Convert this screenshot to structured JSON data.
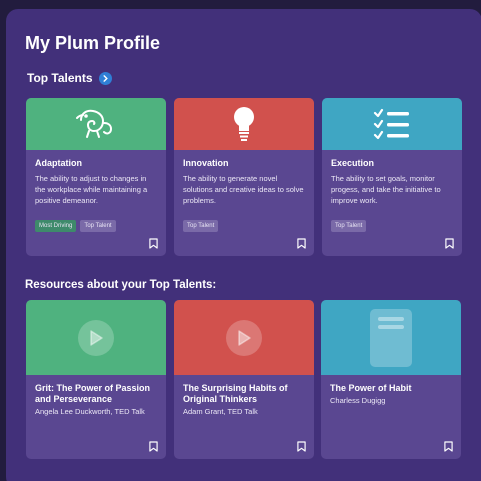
{
  "page_title": "My Plum Profile",
  "top_talents": {
    "heading": "Top Talents",
    "cards": [
      {
        "title": "Adaptation",
        "description": "The ability to adjust to changes in the workplace while maintaining a positive demeanor.",
        "tags": [
          "Most Driving",
          "Top Talent"
        ],
        "icon": "chameleon-icon",
        "color": "#4fb27f"
      },
      {
        "title": "Innovation",
        "description": "The ability to generate novel solutions and creative ideas to solve problems.",
        "tags": [
          "Top Talent"
        ],
        "icon": "lightbulb-icon",
        "color": "#d1514d"
      },
      {
        "title": "Execution",
        "description": "The ability to set goals, monitor progess, and take the initiative to improve work.",
        "tags": [
          "Top Talent"
        ],
        "icon": "checklist-icon",
        "color": "#3fa6c3"
      }
    ]
  },
  "resources": {
    "heading": "Resources about your Top Talents:",
    "cards": [
      {
        "title": "Grit: The Power of Passion and Perseverance",
        "author": "Angela Lee Duckworth, TED Talk",
        "icon": "play-icon",
        "color": "#4fb27f"
      },
      {
        "title": "The Surprising Habits of Original Thinkers",
        "author": "Adam Grant, TED Talk",
        "icon": "play-icon",
        "color": "#d1514d"
      },
      {
        "title": "The Power of Habit",
        "author": "Charless Dugigg",
        "icon": "book-icon",
        "color": "#3fa6c3"
      }
    ]
  }
}
